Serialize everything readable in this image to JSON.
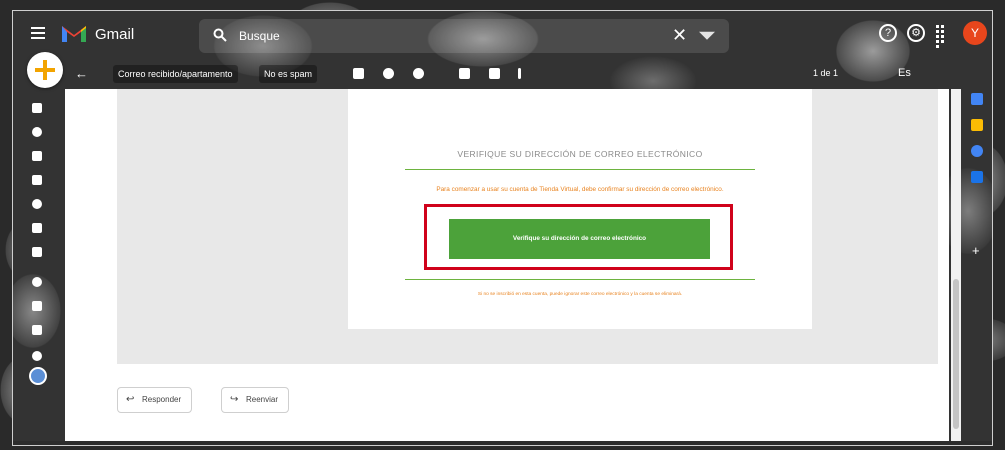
{
  "app": {
    "name": "Gmail"
  },
  "search": {
    "value": "Busque"
  },
  "topbar": {
    "help_glyph": "?",
    "settings_glyph": "⚙",
    "avatar_initial": "Y"
  },
  "toolbar": {
    "back_glyph": "←",
    "chip_1": "Correo recibido/apartamento",
    "chip_2": "No es spam",
    "pager": "1 de 1",
    "keyboard": "Es"
  },
  "email": {
    "title": "VERIFIQUE SU DIRECCIÓN DE CORREO ELECTRÓNICO",
    "body": "Para comenzar a usar su cuenta de Tienda Virtual, debe confirmar su dirección de correo electrónico.",
    "verify_button": "Verifique su dirección de correo electrónico",
    "footer": "Si no se inscribió en esta cuenta, puede ignorar este correo electrónico y la cuenta se eliminará."
  },
  "actions": {
    "reply": "Responder",
    "forward": "Reenviar"
  },
  "colors": {
    "accent_green": "#4ca23a",
    "highlight_red": "#d0021b",
    "text_orange": "#e8821e",
    "avatar": "#e8461c"
  },
  "icons": [
    "menu-icon",
    "gmail-logo-icon",
    "search-icon",
    "close-icon",
    "help-icon",
    "settings-icon",
    "apps-icon",
    "compose-icon",
    "back-arrow-icon",
    "reply-icon",
    "forward-icon"
  ]
}
